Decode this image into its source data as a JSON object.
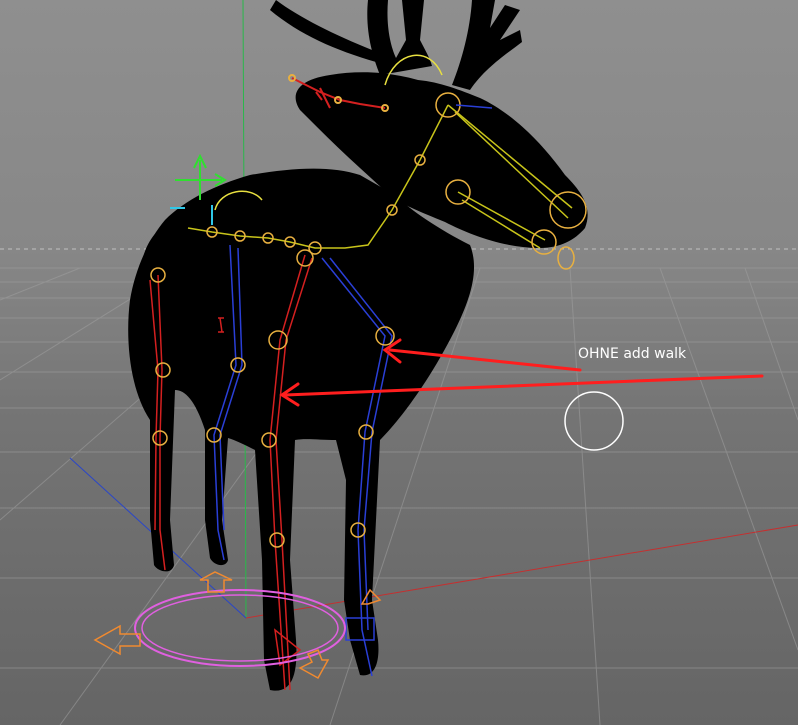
{
  "viewport": {
    "annotation_text": "OHNE add walk",
    "colors": {
      "background_top": "#8f8f8f",
      "background_bottom": "#656565",
      "grid_line": "#9a9a9a",
      "silhouette": "#000000",
      "bone_left": "#d42020",
      "bone_right": "#2a3fd6",
      "bone_spine": "#c8c41a",
      "joint_ring": "#e8b040",
      "arrow": "#ff1e1e",
      "cursor_ring": "#ffffff",
      "controller_ring": "#e060e0",
      "controller_arrows": "#f08a30",
      "axis_y": "#29b84a",
      "axis_x": "#c43030",
      "axis_z": "#2a46c8",
      "move_gizmo": "#2fe02f"
    },
    "icons": [
      "move-gizmo-icon",
      "walk-controller-icon"
    ]
  }
}
